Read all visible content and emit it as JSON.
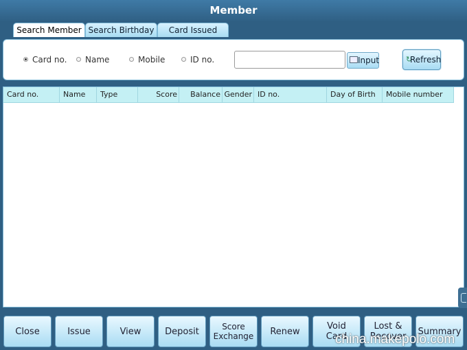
{
  "window": {
    "title": "Member"
  },
  "tabs": [
    {
      "label": "Search Member",
      "active": true
    },
    {
      "label": "Search Birthday",
      "active": false
    },
    {
      "label": "Card Issued",
      "active": false
    }
  ],
  "search": {
    "options": [
      {
        "label": "Card no.",
        "selected": true
      },
      {
        "label": "Name",
        "selected": false
      },
      {
        "label": "Mobile",
        "selected": false
      },
      {
        "label": "ID no.",
        "selected": false
      }
    ],
    "value": "",
    "input_label": "Input",
    "refresh_label": "Refresh"
  },
  "table": {
    "columns": [
      "Card no.",
      "Name",
      "Type",
      "Score",
      "Balance",
      "Gender",
      "ID no.",
      "Day of Birth",
      "Mobile number"
    ],
    "rows": []
  },
  "actions": [
    "Close",
    "Issue",
    "View",
    "Deposit",
    "Score Exchange",
    "Renew",
    "Void Card",
    "Lost & Recover",
    "Summary"
  ],
  "watermark": "china.makepolo.com",
  "colors": {
    "header_bg": "#2f5f83",
    "grid_header": "#c4f0f4",
    "button_bg": "#a9dcf3"
  }
}
